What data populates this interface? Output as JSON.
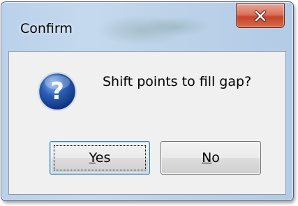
{
  "window": {
    "title": "Confirm",
    "close_icon": "close-x-icon"
  },
  "dialog": {
    "icon": "question-icon",
    "message": "Shift points to fill gap?"
  },
  "buttons": {
    "yes": {
      "mnemonic": "Y",
      "rest": "es"
    },
    "no": {
      "mnemonic": "N",
      "rest": "o"
    }
  },
  "colors": {
    "close_button": "#c7432c",
    "question_icon": "#2a5fb5",
    "dialog_background": "#f0f0f0"
  }
}
